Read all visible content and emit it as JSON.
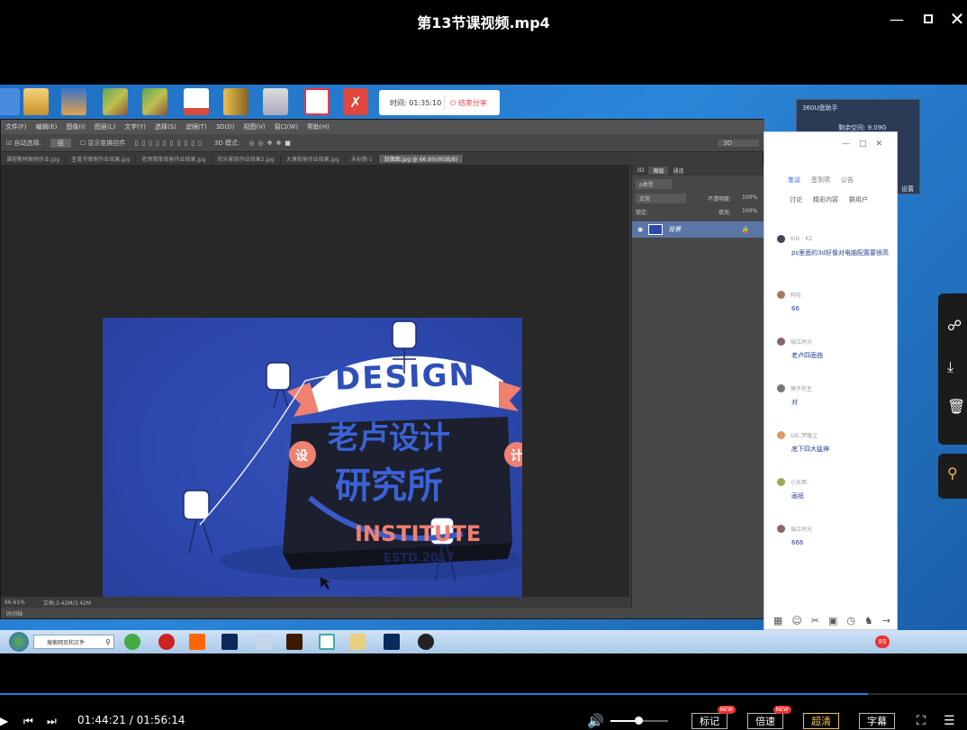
{
  "player": {
    "title": "第13节课视频.mp4",
    "time_current": "01:44:21",
    "time_total": "01:56:14",
    "progress": 0.898,
    "volume": 0.48,
    "buttons": {
      "mark": "标记",
      "speed": "倍速",
      "hd": "超清",
      "subtitle": "字幕"
    },
    "badge_new": "NEW",
    "icons": [
      "minimize-icon",
      "maximize-icon",
      "close-icon",
      "prev-icon",
      "next-icon",
      "volume-icon",
      "fullscreen-icon",
      "playlist-icon"
    ]
  },
  "recording": {
    "timer_label": "时间: 01:35:10",
    "end_share": "结束分享"
  },
  "widget360": {
    "title": "360U盘助手",
    "line1": "剩余空间: 9.09G",
    "settings": "设置"
  },
  "photoshop": {
    "menu": [
      "文件(F)",
      "编辑(E)",
      "图像(I)",
      "图层(L)",
      "文字(Y)",
      "选择(S)",
      "滤镜(T)",
      "3D(D)",
      "视图(V)",
      "窗口(W)",
      "帮助(H)"
    ],
    "options": {
      "auto_select": "自动选择:",
      "layer": "组",
      "show_transform": "显示变换控件",
      "mode3d": "3D 模式:",
      "right": "3D"
    },
    "tabs": [
      "课程教材案例作业.jpg",
      "圣诞节案例作业效果.jpg",
      "老师简单背景作业效果.jpg",
      "欢乐家族作业效果2.jpg",
      "大漠背景作业效果.jpg",
      "未标题-1",
      "封面图.jpg @ 66.6%(RGB/8)"
    ],
    "active_tab_index": 6,
    "status_zoom": "66.61%",
    "status_doc": "文档:3.42M/3.42M",
    "timeline": "时间轴",
    "panel_tabs": [
      "3D",
      "图层",
      "通道"
    ],
    "panel_kind": "ρ类型",
    "blend_mode": "正常",
    "opacity_label": "不透明度:",
    "opacity_value": "100%",
    "lock_label": "锁定:",
    "fill_label": "填充:",
    "fill_value": "100%",
    "layer_name": "背景"
  },
  "artwork": {
    "design": "DESIGN",
    "line1": "老卢设计",
    "line2": "研究所",
    "institute": "INSTITUTE",
    "estd": "ESTD.2017",
    "badge_left": "设",
    "badge_right": "计"
  },
  "chat": {
    "tabs": [
      "笔谈",
      "签到项",
      "公告"
    ],
    "subtabs": [
      "讨论",
      "精彩内容",
      "群用户"
    ],
    "messages": [
      {
        "user": "Kiki · K2",
        "text": "ps里面的3d好像对电脑配置要很高"
      },
      {
        "user": "阿哇",
        "text": "66"
      },
      {
        "user": "瑞江时光",
        "text": "老卢四面曲"
      },
      {
        "user": "狮子先生",
        "text": "对"
      },
      {
        "user": "UIE-梦暖尘",
        "text": "底下四大猛神"
      },
      {
        "user": "小东西",
        "text": "画纸"
      },
      {
        "user": "瑞江时光",
        "text": "666"
      }
    ],
    "icons": [
      "apps-icon",
      "emoji-icon",
      "scissors-icon",
      "image-icon",
      "clock-icon",
      "bell-icon",
      "arrow-right-icon"
    ]
  },
  "taskbar": {
    "search_placeholder": "搜索网页和文件",
    "badge": "89"
  },
  "colors": {
    "accent": "#1e7fe0",
    "art_bg": "#2d48ad",
    "art_coral": "#f08070",
    "art_white": "#ffffff"
  }
}
